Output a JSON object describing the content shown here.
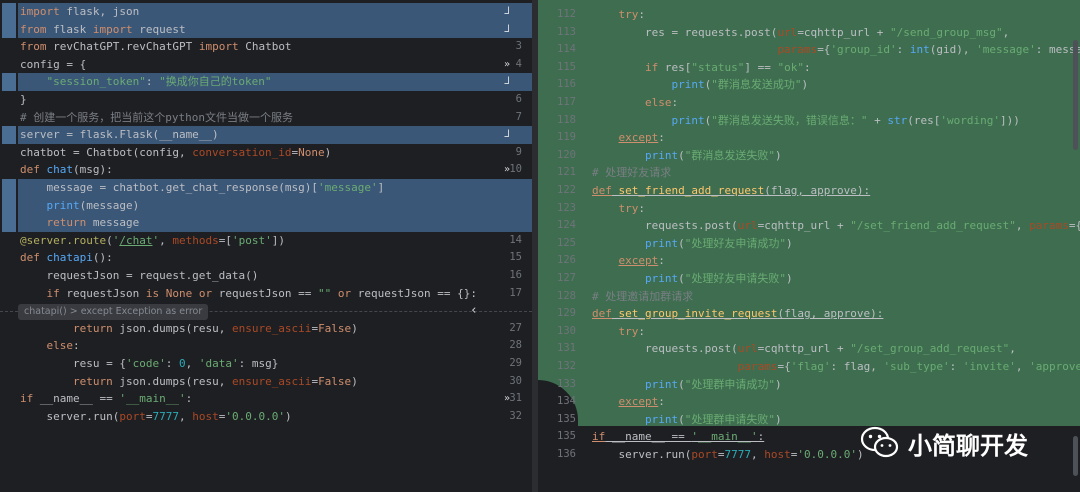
{
  "left": {
    "fold_label": "chatapi()  >  except Exception as error",
    "rows": [
      {
        "ln": "",
        "hl": true,
        "mark": "ᒧ",
        "html": "<span class='k'>import</span> flask, json"
      },
      {
        "ln": "",
        "hl": true,
        "mark": "ᒧ",
        "html": "<span class='k'>from</span> flask <span class='k'>import</span> request"
      },
      {
        "ln": "3",
        "hl": false,
        "mark": "",
        "html": "<span class='k'>from</span> revChatGPT.revChatGPT <span class='k'>import</span> Chatbot"
      },
      {
        "ln": "4",
        "hl": false,
        "mark": "»",
        "html": "config = {"
      },
      {
        "ln": "",
        "hl": true,
        "mark": "ᒧ",
        "html": "    <span class='s'>\"session_token\"</span>: <span class='s'>\"换成你自己的token\"</span>"
      },
      {
        "ln": "6",
        "hl": false,
        "mark": "",
        "html": "}"
      },
      {
        "ln": "7",
        "hl": false,
        "mark": "",
        "html": "<span class='c'># 创建一个服务，把当前这个python文件当做一个服务</span>"
      },
      {
        "ln": "",
        "hl": true,
        "mark": "ᒧ",
        "html": "server = flask.Flask(__name__)"
      },
      {
        "ln": "9",
        "hl": false,
        "mark": "",
        "html": "chatbot = Chatbot(config, <span class='p'>conversation_id</span>=<span class='k'>None</span>)"
      },
      {
        "ln": "10",
        "hl": false,
        "mark": "»",
        "html": "<span class='k'>def</span> <span class='f'>chat</span>(msg):"
      },
      {
        "ln": "",
        "hl": true,
        "mark": "",
        "html": "    message = chatbot.get_chat_response(msg)[<span class='s'>'message'</span>]"
      },
      {
        "ln": "",
        "hl": true,
        "mark": "",
        "html": "    <span class='f'>print</span>(message)"
      },
      {
        "ln": "",
        "hl": true,
        "mark": "",
        "html": "    <span class='k'>return</span> message"
      },
      {
        "ln": "14",
        "hl": false,
        "mark": "",
        "html": "<span class='d'>@server.route</span>(<span class='s'>'<span class=\"u\">/chat</span>'</span>, <span class='p'>methods</span>=[<span class='s'>'post'</span>])"
      },
      {
        "ln": "15",
        "hl": false,
        "mark": "",
        "html": "<span class='k'>def</span> <span class='f'>chatapi</span>():"
      },
      {
        "ln": "16",
        "hl": false,
        "mark": "",
        "html": "    requestJson = request.get_data()"
      },
      {
        "ln": "17",
        "hl": false,
        "mark": "",
        "html": "    <span class='k'>if</span> requestJson <span class='k'>is None or</span> requestJson == <span class='s'>\"\"</span> <span class='k'>or</span> requestJson == {}:"
      },
      {
        "ln": "",
        "hl": false,
        "mark": "",
        "html": ""
      },
      {
        "ln": "27",
        "hl": false,
        "mark": "",
        "html": "        <span class='k'>return</span> json.dumps(resu, <span class='p'>ensure_ascii</span>=<span class='k'>False</span>)"
      },
      {
        "ln": "28",
        "hl": false,
        "mark": "",
        "html": "    <span class='k'>else</span>:"
      },
      {
        "ln": "29",
        "hl": false,
        "mark": "",
        "html": "        resu = {<span class='s'>'code'</span>: <span class='n'>0</span>, <span class='s'>'data'</span>: msg}"
      },
      {
        "ln": "30",
        "hl": false,
        "mark": "",
        "html": "        <span class='k'>return</span> json.dumps(resu, <span class='p'>ensure_ascii</span>=<span class='k'>False</span>)"
      },
      {
        "ln": "31",
        "hl": false,
        "mark": "»",
        "html": "<span class='k'>if</span> __name__ == <span class='s'>'__main__'</span>:"
      },
      {
        "ln": "32",
        "hl": false,
        "mark": "",
        "html": "    server.run(<span class='p'>port</span>=<span class='n'>7777</span>, <span class='p'>host</span>=<span class='s'>'0.0.0.0'</span>)"
      }
    ]
  },
  "right": {
    "rows": [
      {
        "ln": "112",
        "html": "    <span class='k'>try</span>:"
      },
      {
        "ln": "113",
        "html": "        res = requests.post(<span class='p'>url</span>=cqhttp_url + <span class='s'>\"/send_group_msg\"</span>,"
      },
      {
        "ln": "114",
        "html": "                            <span class='p'>params</span>={<span class='s'>'group_id'</span>: <span class='f'>int</span>(gid), <span class='s'>'message'</span>: message})"
      },
      {
        "ln": "115",
        "html": "        <span class='k'>if</span> res[<span class='s'>\"status\"</span>] == <span class='s'>\"ok\"</span>:"
      },
      {
        "ln": "116",
        "html": "            <span class='f'>print</span>(<span class='s'>\"群消息发送成功\"</span>)"
      },
      {
        "ln": "117",
        "html": "        <span class='k'>else</span>:"
      },
      {
        "ln": "118",
        "html": "            <span class='f'>print</span>(<span class='s'>\"群消息发送失败，错误信息：\"</span> + <span class='f'>str</span>(res[<span class='s'>'wording'</span>]))"
      },
      {
        "ln": "119",
        "html": "    <span class='k u'>except</span>:"
      },
      {
        "ln": "120",
        "html": "        <span class='f'>print</span>(<span class='s'>\"群消息发送失败\"</span>)"
      },
      {
        "ln": "121",
        "html": "<span class='c'># 处理好友请求</span>"
      },
      {
        "ln": "122",
        "html": "<span class='k u'>def</span><span class='u'> <span class='y'>set_friend_add_request</span>(flag, approve):</span>"
      },
      {
        "ln": "123",
        "html": "    <span class='k'>try</span>:"
      },
      {
        "ln": "124",
        "html": "        requests.post(<span class='p'>url</span>=cqhttp_url + <span class='s'>\"/set_friend_add_request\"</span>, <span class='p'>params</span>={<span class='s'>'flag'</span>: flag, <span class='s'>'approve'</span>: approve})"
      },
      {
        "ln": "125",
        "html": "        <span class='f'>print</span>(<span class='s'>\"处理好友申请成功\"</span>)"
      },
      {
        "ln": "126",
        "html": "    <span class='k u'>except</span>:"
      },
      {
        "ln": "127",
        "html": "        <span class='f'>print</span>(<span class='s'>\"处理好友申请失败\"</span>)"
      },
      {
        "ln": "128",
        "html": "<span class='c'># 处理邀请加群请求</span>"
      },
      {
        "ln": "129",
        "html": "<span class='k u'>def</span><span class='u'> <span class='y'>set_group_invite_request</span>(flag, approve):</span>"
      },
      {
        "ln": "130",
        "html": "    <span class='k'>try</span>:"
      },
      {
        "ln": "131",
        "html": "        requests.post(<span class='p'>url</span>=cqhttp_url + <span class='s'>\"/set_group_add_request\"</span>,"
      },
      {
        "ln": "132",
        "html": "                      <span class='p'>params</span>={<span class='s'>'flag'</span>: flag, <span class='s'>'sub_type'</span>: <span class='s'>'invite'</span>, <span class='s'>'approve'</span>: approve})"
      },
      {
        "ln": "133",
        "html": "        <span class='f'>print</span>(<span class='s'>\"处理群申请成功\"</span>)"
      },
      {
        "ln": "134",
        "html": "    <span class='k u'>except</span>:"
      },
      {
        "ln": "135",
        "html": "        <span class='f'>print</span>(<span class='s'>\"处理群申请失败\"</span>)"
      },
      {
        "ln": "135",
        "html": "<span class='k u'>if</span><span class='u'> __name__ == <span class='s'>'__main__'</span>:</span>"
      },
      {
        "ln": "136",
        "html": "    server.run(<span class='p'>port</span>=<span class='n'>7777</span>, <span class='p'>host</span>=<span class='s'>'0.0.0.0'</span>)"
      }
    ]
  },
  "watermark": {
    "text": "小简聊开发"
  },
  "icons": [
    "check-icon",
    "wechat-icon",
    "bookmark-icon",
    "fold-icon"
  ],
  "colors": {
    "highlight_blue": "#3b5777",
    "highlight_green": "#3e6e4f",
    "background": "#1e1f22"
  }
}
